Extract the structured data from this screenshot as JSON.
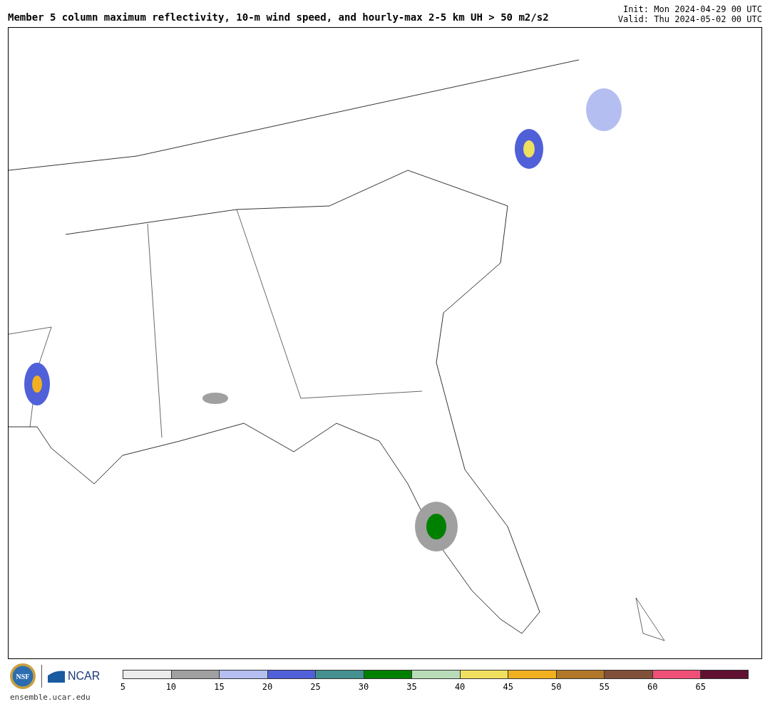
{
  "header": {
    "title": "Member 5 column maximum reflectivity, 10-m wind speed, and hourly-max 2-5 km UH > 50 m2/s2",
    "init": "Init: Mon 2024-04-29 00 UTC",
    "valid": "Valid: Thu 2024-05-02 00 UTC"
  },
  "footer": {
    "nsf_logo": "NSF",
    "ncar_logo": "NCAR",
    "site": "ensemble.ucar.edu"
  },
  "colorbar": {
    "bins": [
      {
        "label": "5",
        "color": "#ececec"
      },
      {
        "label": "10",
        "color": "#a0a0a0"
      },
      {
        "label": "15",
        "color": "#b4bef0"
      },
      {
        "label": "20",
        "color": "#5060d8"
      },
      {
        "label": "25",
        "color": "#449090"
      },
      {
        "label": "30",
        "color": "#008000"
      },
      {
        "label": "35",
        "color": "#b8dcb8"
      },
      {
        "label": "40",
        "color": "#f0e060"
      },
      {
        "label": "45",
        "color": "#f0b020"
      },
      {
        "label": "50",
        "color": "#b07828"
      },
      {
        "label": "55",
        "color": "#805038"
      },
      {
        "label": "60",
        "color": "#f05078"
      },
      {
        "label": "65",
        "color": "#601030"
      }
    ]
  }
}
